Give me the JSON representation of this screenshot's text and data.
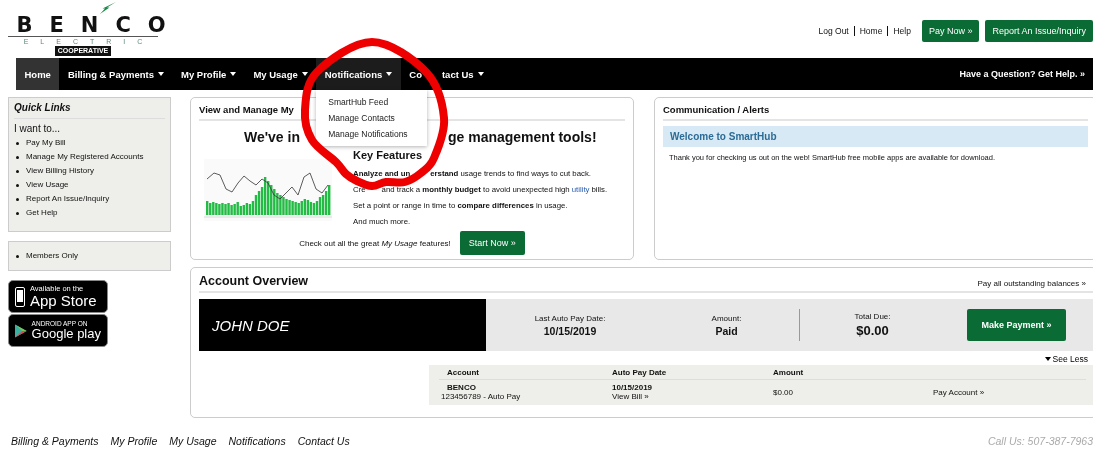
{
  "logo": {
    "name": "BENCO",
    "tagline": "ELECTRIC",
    "badge": "COOPERATIVE"
  },
  "top_links": [
    "Log Out",
    "Home",
    "Help"
  ],
  "top_buttons": [
    "Pay Now »",
    "Report An Issue/Inquiry"
  ],
  "nav": {
    "items": [
      {
        "label_parts": [
          "Home"
        ],
        "selected": true,
        "dropdown": false,
        "open": false
      },
      {
        "label_parts": [
          "Billing & Payments"
        ],
        "selected": false,
        "dropdown": true,
        "open": false
      },
      {
        "label_parts": [
          "My Profile"
        ],
        "selected": false,
        "dropdown": true,
        "open": false
      },
      {
        "label_parts": [
          "My Usage"
        ],
        "selected": false,
        "dropdown": true,
        "open": false
      },
      {
        "label_parts": [
          "Notifications"
        ],
        "selected": false,
        "dropdown": true,
        "open": true,
        "menu": [
          "SmartHub Feed",
          "Manage Contacts",
          "Manage Notifications"
        ]
      },
      {
        "label_parts": [
          "Co",
          "tact Us"
        ],
        "selected": false,
        "dropdown": true,
        "open": false
      }
    ],
    "help": "Have a Question? Get Help. »"
  },
  "sidebar": {
    "quick_links": {
      "title": "Quick Links",
      "lead": "I want to...",
      "items": [
        "Pay My Bill",
        "Manage My Registered Accounts",
        "View Billing History",
        "View Usage",
        "Report An Issue/Inquiry",
        "Get Help"
      ]
    },
    "members": [
      "Members Only"
    ],
    "app_badges": [
      {
        "kind": "apple",
        "small": "Available on the",
        "big": "App Store"
      },
      {
        "kind": "google",
        "small": "ANDROID APP ON",
        "big": "Google play"
      }
    ]
  },
  "usage_card": {
    "title": "View and Manage My",
    "headline_parts": [
      "We've in",
      "ge management tools!"
    ],
    "features_title": "Key Features",
    "features": [
      {
        "parts": [
          "**Analyze and un**",
          "**erstand** usage trends to find ways to cut back."
        ]
      },
      {
        "parts": [
          "Cre",
          "and track a **monthly budget** to avoid unexpected high"
        ],
        "link": "utility",
        "tail": "bills."
      },
      {
        "parts": [
          "Set a point or range in time to **compare differences** in usage."
        ]
      },
      {
        "parts": [
          "And much more."
        ]
      }
    ],
    "cta_text": "Check out all the great *My Usage* features!",
    "cta_button": "Start Now »"
  },
  "alerts_card": {
    "title": "Communication / Alerts",
    "alerts": [
      {
        "title": "Welcome to SmartHub",
        "body": "Thank you for checking us out on the web! SmartHub free mobile apps are available for download."
      }
    ]
  },
  "account_overview": {
    "title": "Account Overview",
    "pay_all": "Pay all outstanding balances »",
    "name": "JOHN DOE",
    "stats": [
      {
        "label": "Last Auto Pay Date:",
        "value": "10/15/2019",
        "divider": false
      },
      {
        "label": "Amount:",
        "value": "Paid",
        "divider": true
      },
      {
        "label": "Total Due:",
        "value": "$0.00",
        "divider": false
      }
    ],
    "button": "Make Payment »",
    "toggle": "See Less",
    "expanded": true,
    "table": {
      "columns": [
        "Account",
        "Auto Pay Date",
        "Amount"
      ],
      "rows": [
        {
          "account": "BENCO",
          "account_detail": "123456789 - Auto Pay",
          "date": "10/15/2019",
          "date_link": "View Bill »",
          "amount": "$0.00",
          "action": "Pay Account »"
        }
      ]
    }
  },
  "footer": {
    "links": [
      "Billing & Payments",
      "My Profile",
      "My Usage",
      "Notifications",
      "Contact Us"
    ],
    "phone": "Call Us: 507-387-7963"
  }
}
